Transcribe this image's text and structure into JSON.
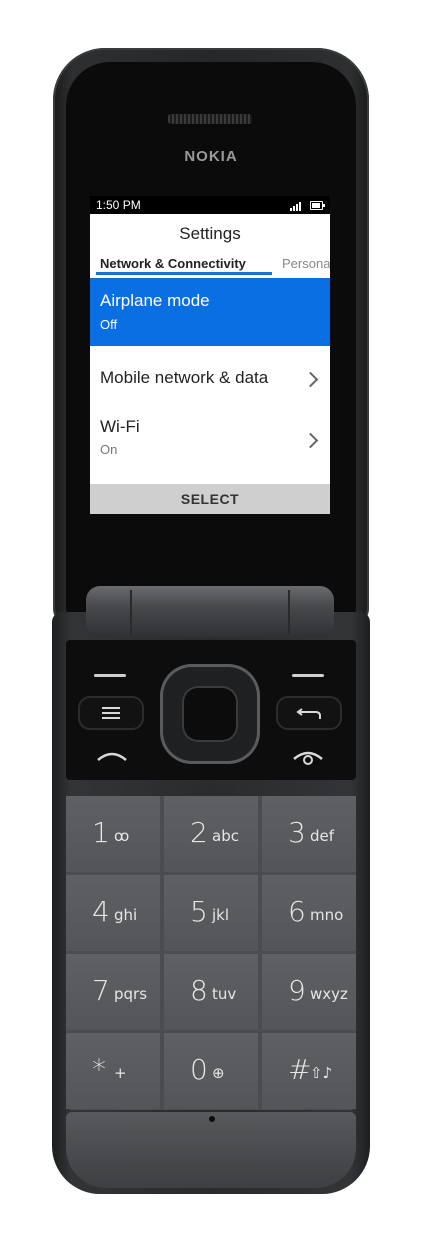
{
  "device": {
    "brand": "NOKIA"
  },
  "status_bar": {
    "time": "1:50 PM"
  },
  "screen": {
    "title": "Settings",
    "tabs": [
      {
        "label": "Network & Connectivity",
        "active": true
      },
      {
        "label": "Persona",
        "active": false
      }
    ],
    "items": [
      {
        "title": "Airplane mode",
        "subtitle": "Off",
        "selected": true
      },
      {
        "title": "Mobile network & data",
        "subtitle": "",
        "selected": false
      },
      {
        "title": "Wi-Fi",
        "subtitle": "On",
        "selected": false
      }
    ],
    "softkey_center": "SELECT"
  },
  "keypad": {
    "keys": [
      {
        "num": "1",
        "letters": "ꝏ"
      },
      {
        "num": "2",
        "letters": "abc"
      },
      {
        "num": "3",
        "letters": "def"
      },
      {
        "num": "4",
        "letters": "ghi"
      },
      {
        "num": "5",
        "letters": "jkl"
      },
      {
        "num": "6",
        "letters": "mno"
      },
      {
        "num": "7",
        "letters": "pqrs"
      },
      {
        "num": "8",
        "letters": "tuv"
      },
      {
        "num": "9",
        "letters": "wxyz"
      },
      {
        "num": "*",
        "letters": "+"
      },
      {
        "num": "0",
        "letters": "⊕"
      },
      {
        "num": "#",
        "letters": "⇧♪"
      }
    ]
  },
  "colors": {
    "accent": "#0a6fe3",
    "tab_underline": "#1a73d6"
  }
}
